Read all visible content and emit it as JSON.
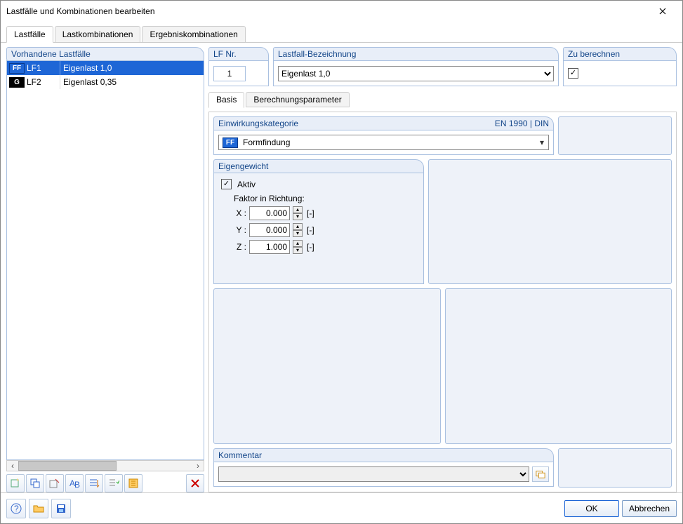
{
  "window": {
    "title": "Lastfälle und Kombinationen bearbeiten"
  },
  "tabs": {
    "t0": "Lastfälle",
    "t1": "Lastkombinationen",
    "t2": "Ergebniskombinationen"
  },
  "left": {
    "header": "Vorhandene Lastfälle",
    "rows": [
      {
        "badge": "FF",
        "badgeClass": "ff",
        "id": "LF1",
        "name": "Eigenlast 1,0",
        "selected": true
      },
      {
        "badge": "G",
        "badgeClass": "g",
        "id": "LF2",
        "name": "Eigenlast 0,35",
        "selected": false
      }
    ]
  },
  "lfnr": {
    "label": "LF Nr.",
    "value": "1"
  },
  "bez": {
    "label": "Lastfall-Bezeichnung",
    "value": "Eigenlast 1,0"
  },
  "zuber": {
    "label": "Zu berechnen",
    "checked": true
  },
  "subtabs": {
    "s0": "Basis",
    "s1": "Berechnungsparameter"
  },
  "ek": {
    "label": "Einwirkungskategorie",
    "norm": "EN 1990 | DIN",
    "badge": "FF",
    "value": "Formfindung"
  },
  "eg": {
    "label": "Eigengewicht",
    "aktiv_label": "Aktiv",
    "aktiv": true,
    "faktor_label": "Faktor in Richtung:",
    "x_label": "X :",
    "x": "0.000",
    "y_label": "Y :",
    "y": "0.000",
    "z_label": "Z :",
    "z": "1.000",
    "unit": "[-]"
  },
  "kommentar": {
    "label": "Kommentar",
    "value": ""
  },
  "footer": {
    "ok": "OK",
    "cancel": "Abbrechen"
  }
}
